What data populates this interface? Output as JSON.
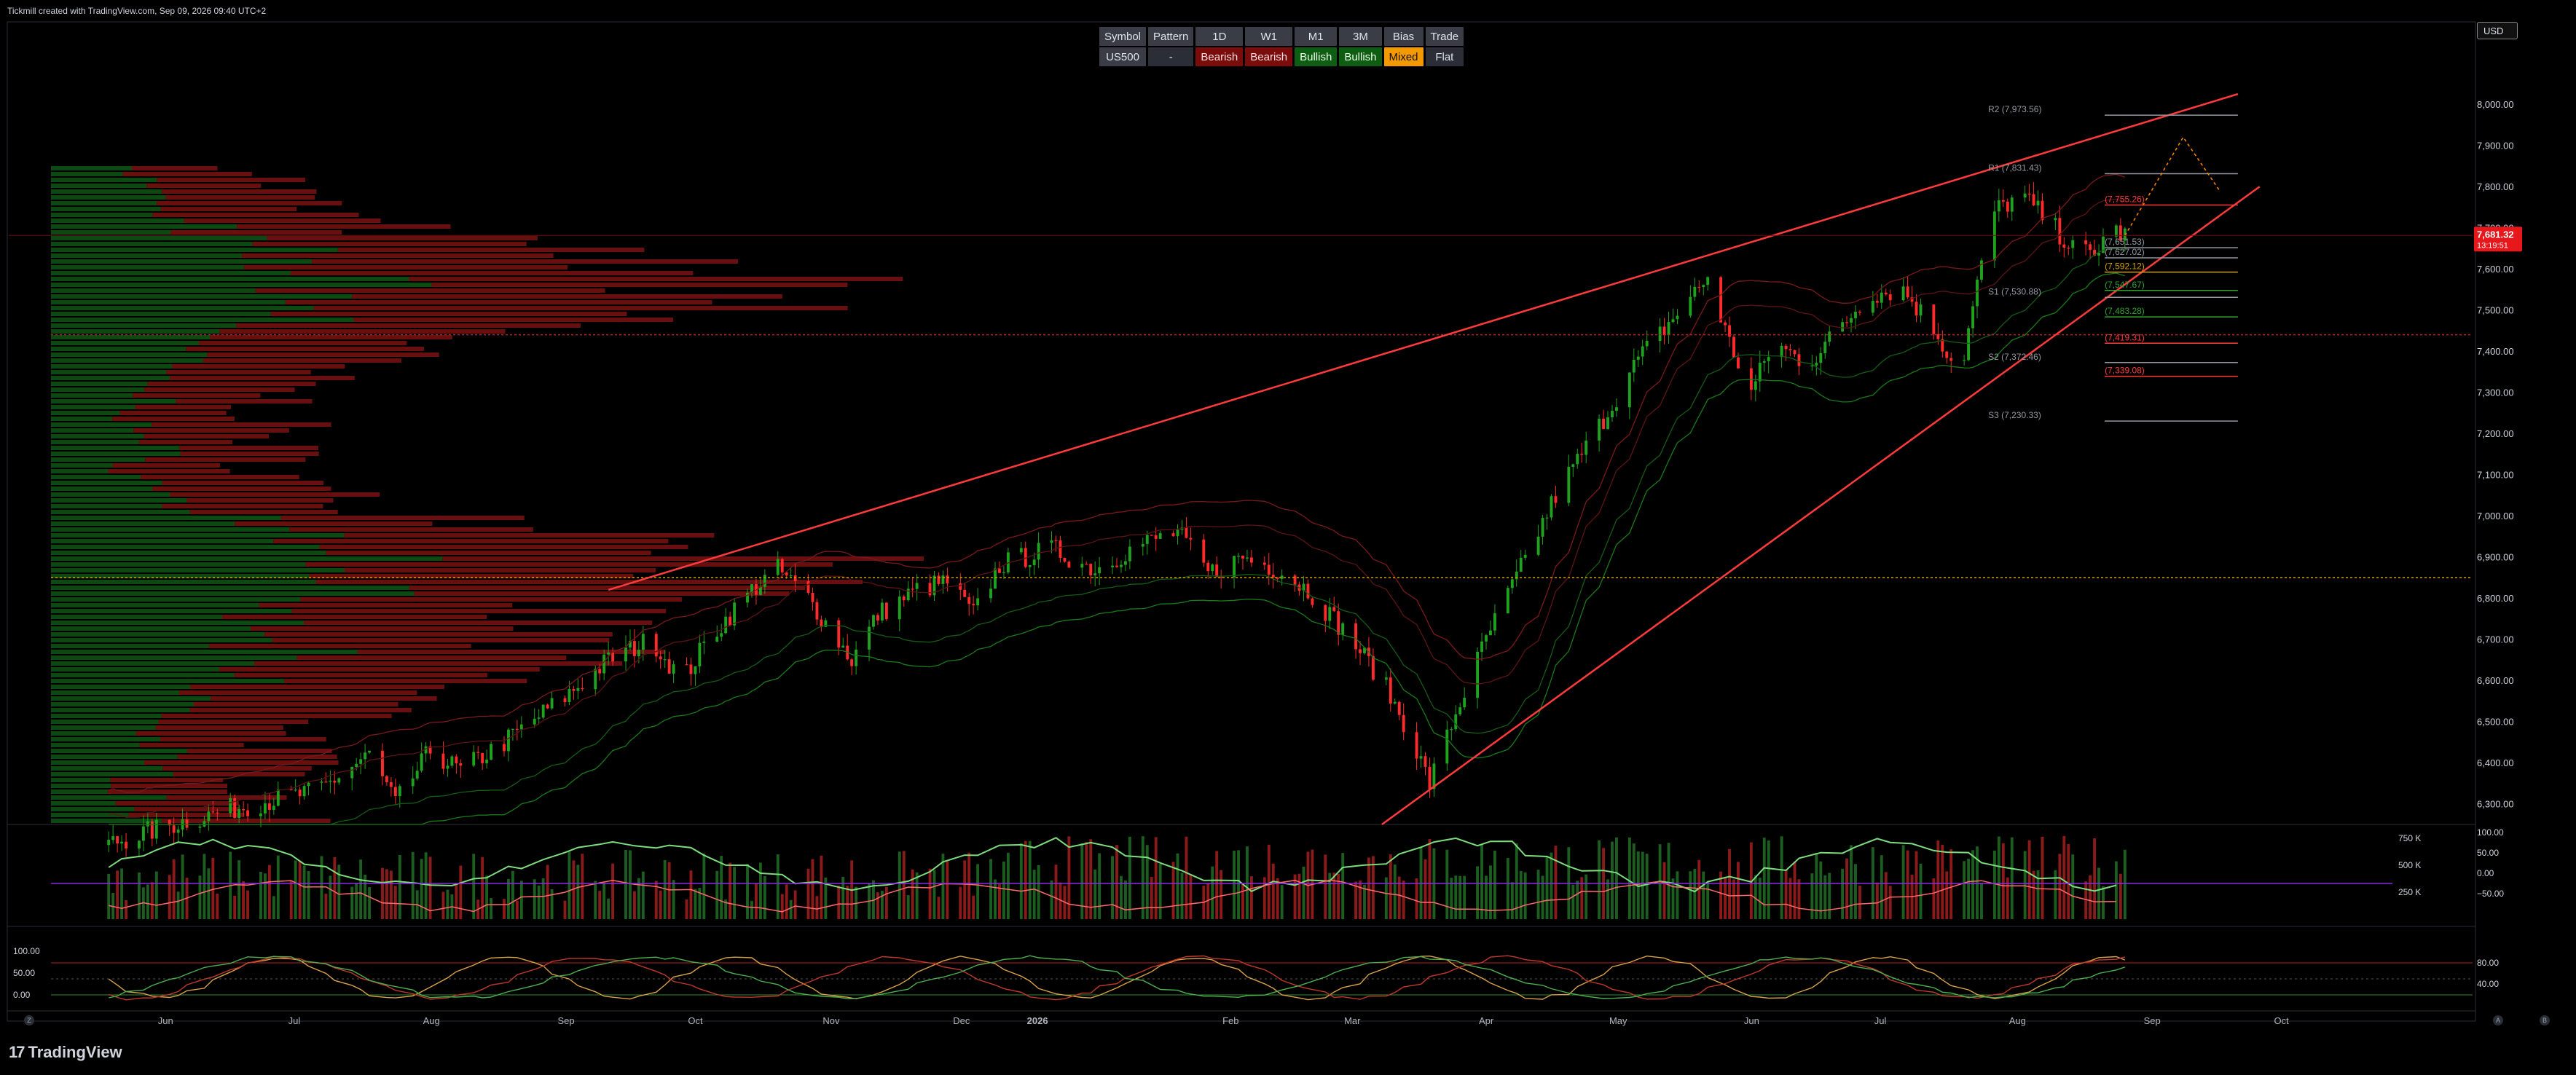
{
  "header": {
    "created_text": "Tickmill created with TradingView.com, Sep 09, 2026 09:40 UTC+2"
  },
  "currency_button": "USD",
  "logo_text": "TradingView",
  "bias_table": {
    "headers": [
      "Symbol",
      "Pattern",
      "1D",
      "W1",
      "M1",
      "3M",
      "Bias",
      "Trade"
    ],
    "values": [
      "US500",
      "-",
      "Bearish",
      "Bearish",
      "Bullish",
      "Bullish",
      "Mixed",
      "Flat"
    ]
  },
  "corner_buttons": {
    "left": "Z",
    "right_a": "A",
    "right_b": "B"
  },
  "colors": {
    "background": "#000000",
    "bull": "#1fa31f",
    "bear": "#ff2a2a",
    "wedge": "#ff3b3b",
    "price_tag": "#e8171c"
  },
  "chart_data": [
    {
      "type": "candlestick",
      "symbol": "US500",
      "x_ticks": [
        "Jun",
        "Jul",
        "Aug",
        "Sep",
        "Oct",
        "Nov",
        "Dec",
        "2026",
        "Feb",
        "Mar",
        "Apr",
        "May",
        "Jun",
        "Jul",
        "Aug",
        "Sep",
        "Oct"
      ],
      "y_ticks": [
        "6,300.00",
        "6,400.00",
        "6,500.00",
        "6,600.00",
        "6,700.00",
        "6,800.00",
        "6,900.00",
        "7,000.00",
        "7,100.00",
        "7,200.00",
        "7,300.00",
        "7,400.00",
        "7,500.00",
        "7,600.00",
        "7,700.00",
        "7,800.00",
        "7,900.00",
        "8,000.00"
      ],
      "ylim": [
        6250,
        8080
      ],
      "last_price": "7,681.32",
      "countdown": "13:19:51",
      "close_path": [
        [
          "2025-06-01",
          6200
        ],
        [
          "2025-06-20",
          6260
        ],
        [
          "2025-07-05",
          6300
        ],
        [
          "2025-07-20",
          6330
        ],
        [
          "2025-08-01",
          6420
        ],
        [
          "2025-08-07",
          6300
        ],
        [
          "2025-08-15",
          6430
        ],
        [
          "2025-08-22",
          6380
        ],
        [
          "2025-09-01",
          6450
        ],
        [
          "2025-09-15",
          6560
        ],
        [
          "2025-09-25",
          6650
        ],
        [
          "2025-10-05",
          6700
        ],
        [
          "2025-10-12",
          6600
        ],
        [
          "2025-10-18",
          6700
        ],
        [
          "2025-10-28",
          6820
        ],
        [
          "2025-11-03",
          6870
        ],
        [
          "2025-11-10",
          6800
        ],
        [
          "2025-11-20",
          6650
        ],
        [
          "2025-11-26",
          6760
        ],
        [
          "2025-12-05",
          6820
        ],
        [
          "2025-12-12",
          6840
        ],
        [
          "2025-12-18",
          6760
        ],
        [
          "2025-12-24",
          6880
        ],
        [
          "2026-01-05",
          6920
        ],
        [
          "2026-01-15",
          6870
        ],
        [
          "2026-01-25",
          6930
        ],
        [
          "2026-02-03",
          6960
        ],
        [
          "2026-02-10",
          6860
        ],
        [
          "2026-02-18",
          6900
        ],
        [
          "2026-02-26",
          6870
        ],
        [
          "2026-03-05",
          6820
        ],
        [
          "2026-03-15",
          6700
        ],
        [
          "2026-03-22",
          6600
        ],
        [
          "2026-03-28",
          6480
        ],
        [
          "2026-04-02",
          6350
        ],
        [
          "2026-04-08",
          6520
        ],
        [
          "2026-04-15",
          6700
        ],
        [
          "2026-04-22",
          6850
        ],
        [
          "2026-05-01",
          7050
        ],
        [
          "2026-05-10",
          7200
        ],
        [
          "2026-05-20",
          7380
        ],
        [
          "2026-05-28",
          7480
        ],
        [
          "2026-06-05",
          7580
        ],
        [
          "2026-06-10",
          7420
        ],
        [
          "2026-06-15",
          7300
        ],
        [
          "2026-06-20",
          7420
        ],
        [
          "2026-06-28",
          7370
        ],
        [
          "2026-07-05",
          7450
        ],
        [
          "2026-07-12",
          7540
        ],
        [
          "2026-07-20",
          7550
        ],
        [
          "2026-07-28",
          7440
        ],
        [
          "2026-08-02",
          7340
        ],
        [
          "2026-08-06",
          7560
        ],
        [
          "2026-08-10",
          7740
        ],
        [
          "2026-08-16",
          7780
        ],
        [
          "2026-08-22",
          7720
        ],
        [
          "2026-08-28",
          7650
        ],
        [
          "2026-09-02",
          7630
        ],
        [
          "2026-09-05",
          7700
        ],
        [
          "2026-09-09",
          7681
        ]
      ],
      "levels": [
        {
          "label": "R2 (7,973.56)",
          "value": 7973.56,
          "color": "#9598a1"
        },
        {
          "label": "R1 (7,831.43)",
          "value": 7831.43,
          "color": "#9598a1"
        },
        {
          "label": "(7,755.26)",
          "value": 7755.26,
          "color": "#ff3b3b"
        },
        {
          "label": "(7,651.53)",
          "value": 7651.53,
          "color": "#9598a1"
        },
        {
          "label": "(7,627.02)",
          "value": 7627.02,
          "color": "#9598a1"
        },
        {
          "label": "(7,592.12)",
          "value": 7592.12,
          "color": "#d4a000"
        },
        {
          "label": "(7,547.67)",
          "value": 7547.67,
          "color": "#2fa32f"
        },
        {
          "label": "S1 (7,530.88)",
          "value": 7530.88,
          "color": "#9598a1"
        },
        {
          "label": "(7,483.28)",
          "value": 7483.28,
          "color": "#2fa32f"
        },
        {
          "label": "(7,419.31)",
          "value": 7419.31,
          "color": "#ff3b3b"
        },
        {
          "label": "S2 (7,372.46)",
          "value": 7372.46,
          "color": "#9598a1"
        },
        {
          "label": "(7,339.08)",
          "value": 7339.08,
          "color": "#ff3b3b"
        },
        {
          "label": "S3 (7,230.33)",
          "value": 7230.33,
          "color": "#9598a1"
        }
      ],
      "wedge": {
        "upper": [
          [
            "2025-09-25",
            6820
          ],
          [
            "2026-10-05",
            8025
          ]
        ],
        "lower": [
          [
            "2026-03-22",
            6250
          ],
          [
            "2026-10-10",
            7800
          ]
        ]
      },
      "dotted_levels": [
        7440,
        6850
      ]
    },
    {
      "type": "bar",
      "name": "volume",
      "y_ticks": [
        "750 K",
        "500 K",
        "250 K"
      ],
      "right_ticks": [
        "100.00",
        "50.00",
        "0.00",
        "−50.00"
      ]
    },
    {
      "type": "line",
      "name": "oscillator",
      "y_ticks": [
        "100.00",
        "50.00",
        "0.00"
      ],
      "right_ticks": [
        "80.00",
        "40.00"
      ]
    }
  ]
}
